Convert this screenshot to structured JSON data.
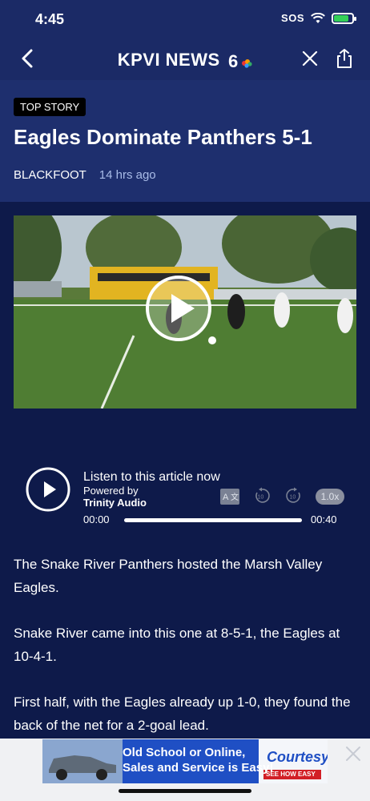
{
  "status_bar": {
    "time": "4:45",
    "sos": "SOS"
  },
  "nav": {
    "title": "KPVI NEWS"
  },
  "story": {
    "badge": "TOP STORY",
    "headline": "Eagles Dominate Panthers 5-1",
    "location": "BLACKFOOT",
    "time_ago": "14 hrs ago"
  },
  "audio": {
    "title": "Listen to this article now",
    "powered_by": "Powered by",
    "provider": "Trinity Audio",
    "speed": "1.0x",
    "current_time": "00:00",
    "duration": "00:40",
    "progress": 0
  },
  "article": {
    "paragraphs": [
      "The Snake River Panthers hosted the Marsh Valley Eagles.",
      "Snake River came into this one at 8-5-1, the Eagles at 10-4-1.",
      "First half, with the Eagles already up 1-0, they found the back of the net for a 2-goal lead."
    ]
  },
  "ad": {
    "line1": "Old School or  Online,",
    "line2": "Sales and Service is Easy!",
    "brand": "Courtesy",
    "cta": "SEE HOW EASY"
  },
  "colors": {
    "background": "#0e1a4a",
    "header": "#1e2f6e",
    "nav": "#1b2a66",
    "accent_time": "#a9bce8"
  }
}
